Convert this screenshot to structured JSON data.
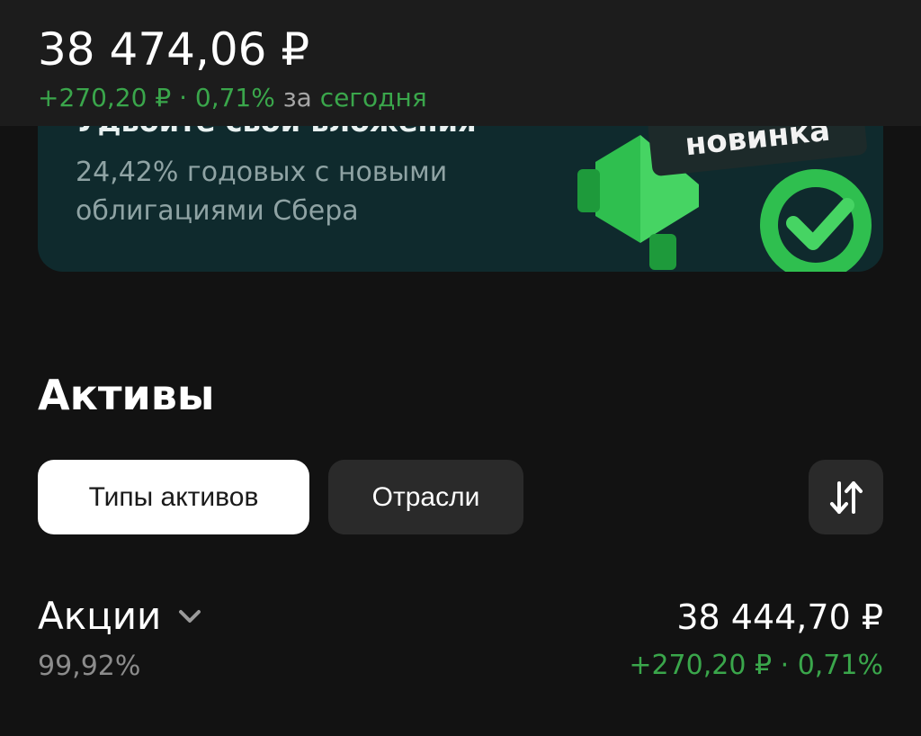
{
  "header": {
    "total": "38 474,06 ₽",
    "change_amount": "+270,20 ₽",
    "separator": "·",
    "change_percent": "0,71%",
    "period_prefix": "за",
    "period": "сегодня"
  },
  "banner": {
    "title": "Удвойте свои вложения",
    "text": "24,42% годовых с новыми облигациями Сбера",
    "badge": "новинка"
  },
  "assets": {
    "title": "Активы",
    "tabs": [
      "Типы активов",
      "Отрасли"
    ],
    "selected_tab": "Типы активов",
    "sort_icon": "sort-arrows-icon",
    "rows": [
      {
        "name": "Акции",
        "share": "99,92%",
        "value": "38 444,70 ₽",
        "change_amount": "+270,20 ₽",
        "separator": "·",
        "change_percent": "0,71%"
      }
    ]
  },
  "colors": {
    "background": "#121212",
    "header": "#1c1c1c",
    "positive": "#3aa64b",
    "banner": "#0f2a2d",
    "chip_inactive": "#2a2a2a"
  }
}
